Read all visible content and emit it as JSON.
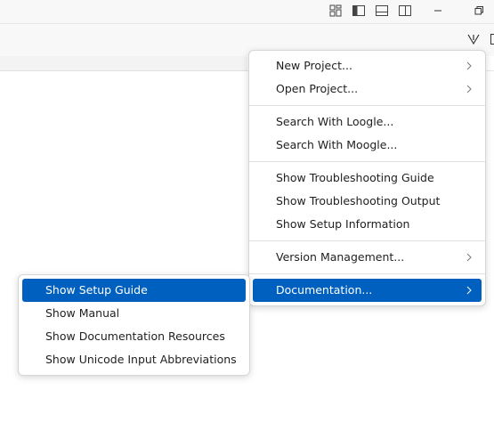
{
  "titlebar": {
    "icons": [
      "customize-layout-icon",
      "toggle-primary-sidebar-icon",
      "toggle-panel-icon",
      "toggle-secondary-sidebar-icon",
      "minimize-icon",
      "restore-icon"
    ]
  },
  "toolbar": {
    "icons": [
      "filter-icon",
      "split-editor-icon"
    ]
  },
  "main_menu": {
    "groups": [
      [
        {
          "label": "New Project...",
          "submenu": true
        },
        {
          "label": "Open Project...",
          "submenu": true
        }
      ],
      [
        {
          "label": "Search With Loogle..."
        },
        {
          "label": "Search With Moogle..."
        }
      ],
      [
        {
          "label": "Show Troubleshooting Guide"
        },
        {
          "label": "Show Troubleshooting Output"
        },
        {
          "label": "Show Setup Information"
        }
      ],
      [
        {
          "label": "Version Management...",
          "submenu": true
        }
      ],
      [
        {
          "label": "Documentation...",
          "submenu": true,
          "active": true
        }
      ]
    ]
  },
  "sub_menu": {
    "items": [
      {
        "label": "Show Setup Guide",
        "active": true
      },
      {
        "label": "Show Manual"
      },
      {
        "label": "Show Documentation Resources"
      },
      {
        "label": "Show Unicode Input Abbreviations"
      }
    ]
  },
  "colors": {
    "accent": "#0060c0",
    "menu_background": "#ffffff",
    "chrome_background": "#f8f8f8"
  }
}
